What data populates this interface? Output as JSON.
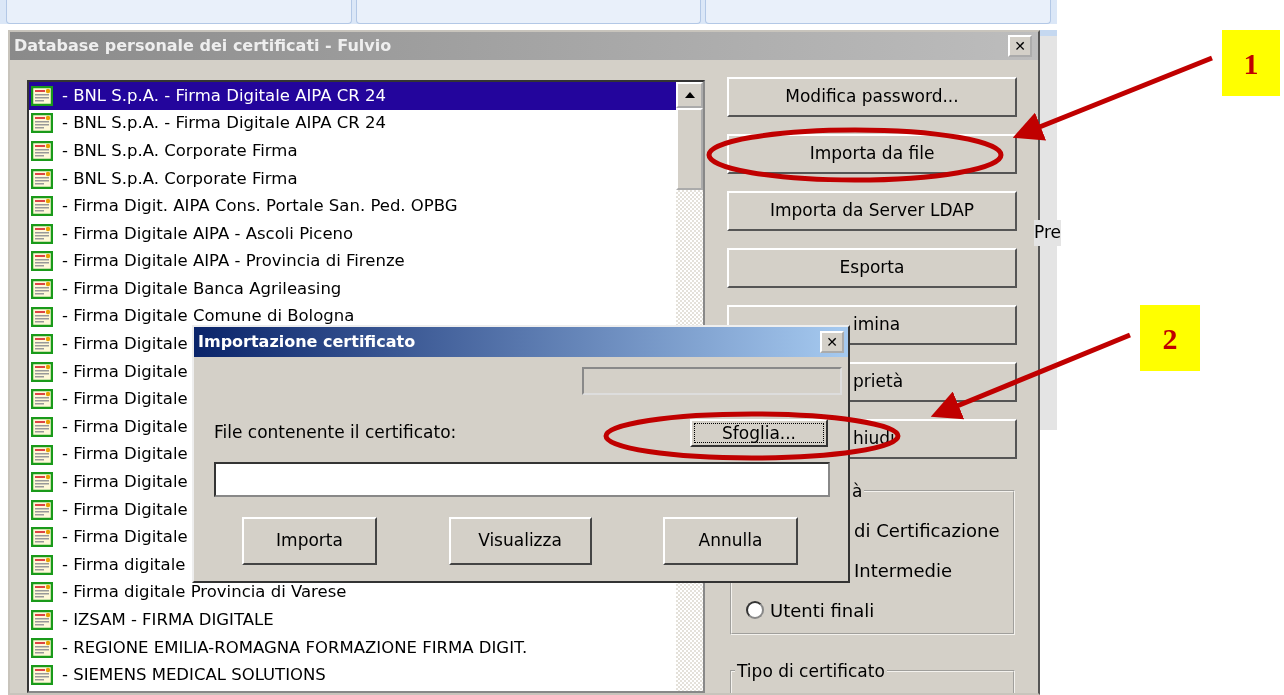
{
  "background": {
    "side_text": "Pre"
  },
  "main_window": {
    "title": "Database personale dei certificati - Fulvio",
    "close_label": "✕",
    "certificates": [
      {
        "label": "- BNL S.p.A. - Firma Digitale AIPA CR 24",
        "selected": true
      },
      {
        "label": "- BNL S.p.A. - Firma Digitale AIPA CR 24",
        "selected": false
      },
      {
        "label": "- BNL S.p.A. Corporate Firma",
        "selected": false
      },
      {
        "label": "- BNL S.p.A. Corporate Firma",
        "selected": false
      },
      {
        "label": "- Firma Digit. AIPA Cons. Portale San. Ped. OPBG",
        "selected": false
      },
      {
        "label": "- Firma Digitale AIPA - Ascoli Piceno",
        "selected": false
      },
      {
        "label": "- Firma Digitale AIPA - Provincia di Firenze",
        "selected": false
      },
      {
        "label": "- Firma Digitale Banca Agrileasing",
        "selected": false
      },
      {
        "label": "- Firma Digitale Comune di Bologna",
        "selected": false
      },
      {
        "label": "- Firma Digitale",
        "selected": false
      },
      {
        "label": "- Firma Digitale",
        "selected": false
      },
      {
        "label": "- Firma Digitale",
        "selected": false
      },
      {
        "label": "- Firma Digitale",
        "selected": false
      },
      {
        "label": "- Firma Digitale",
        "selected": false
      },
      {
        "label": "- Firma Digitale",
        "selected": false
      },
      {
        "label": "- Firma Digitale",
        "selected": false
      },
      {
        "label": "- Firma Digitale",
        "selected": false
      },
      {
        "label": "- Firma digitale",
        "selected": false
      },
      {
        "label": "- Firma digitale Provincia di Varese",
        "selected": false
      },
      {
        "label": "- IZSAM - FIRMA DIGITALE",
        "selected": false
      },
      {
        "label": "- REGIONE EMILIA-ROMAGNA FORMAZIONE FIRMA DIGIT.",
        "selected": false
      },
      {
        "label": "- SIEMENS MEDICAL SOLUTIONS",
        "selected": false
      }
    ],
    "buttons": [
      "Modifica password...",
      "Importa da file",
      "Importa da Server LDAP",
      "Esporta",
      "imina",
      "prietà",
      "hiudi"
    ],
    "authority_group": {
      "label": "à",
      "options": [
        {
          "kind": "text",
          "label": "di Certificazione"
        },
        {
          "kind": "text",
          "label": "Intermedie"
        },
        {
          "kind": "radio",
          "label": "Utenti finali",
          "selected": false
        }
      ]
    },
    "type_group": {
      "label": "Tipo di certificato"
    }
  },
  "import_dialog": {
    "title": "Importazione certificato",
    "close_label": "✕",
    "progress": {
      "level": 0
    },
    "file_label": "File contenente il certificato:",
    "browse_button": "Sfoglia...",
    "buttons": [
      "Importa",
      "Visualizza",
      "Annulla"
    ]
  },
  "annotations": [
    {
      "label": "1"
    },
    {
      "label": "2"
    }
  ]
}
